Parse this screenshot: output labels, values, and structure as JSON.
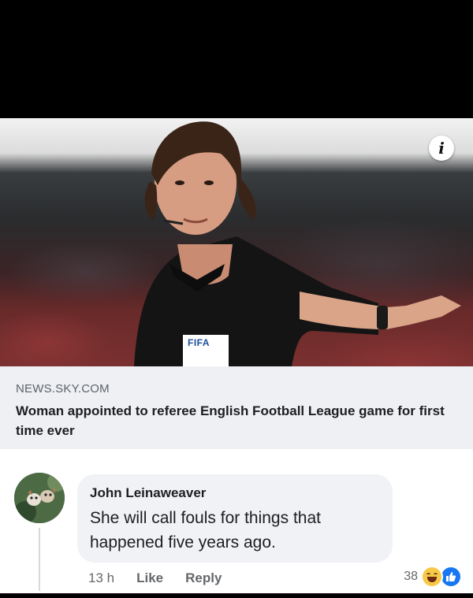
{
  "link_preview": {
    "domain": "NEWS.SKY.COM",
    "headline": "Woman appointed to referee English Football League game for first time ever",
    "info_icon": "i",
    "badge_text": "FIFA"
  },
  "comment": {
    "author": "John Leinaweaver",
    "text": "She will call fouls for things that happened five years ago.",
    "time": "13 h",
    "like_label": "Like",
    "reply_label": "Reply",
    "reaction_count": "38",
    "reactions": [
      "haha-icon",
      "like-icon"
    ]
  },
  "colors": {
    "like_blue": "#1877f2",
    "haha_yellow": "#f7c948",
    "bubble_bg": "#f0f2f5",
    "meta_bg": "#eef0f3"
  }
}
